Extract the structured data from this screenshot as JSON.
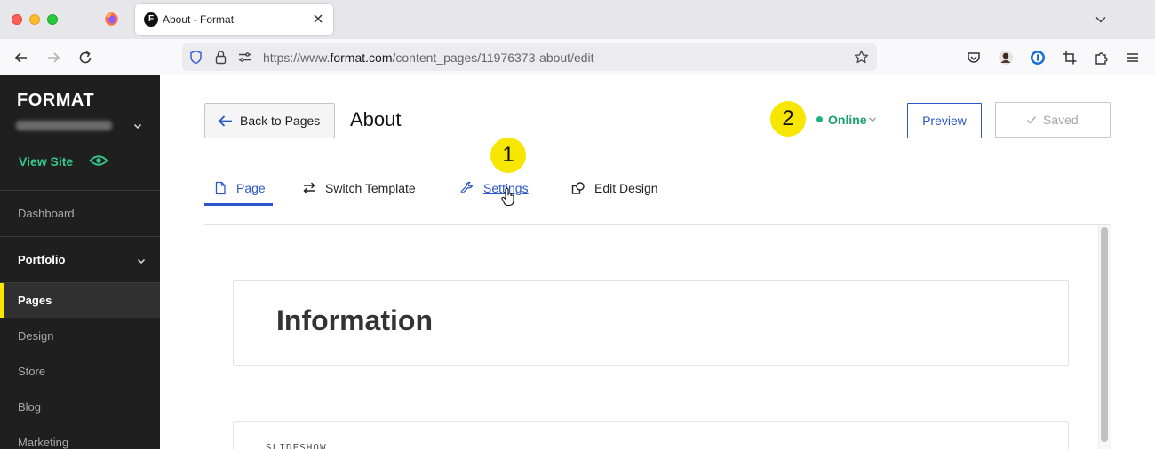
{
  "browser": {
    "tab_title": "About - Format",
    "tab_favicon_letter": "F",
    "url_prefix": "https://www.",
    "url_host": "format.com",
    "url_path": "/content_pages/11976373-about/edit"
  },
  "sidebar": {
    "brand": "FORMAT",
    "view_site": "View Site",
    "items": {
      "dashboard": "Dashboard",
      "portfolio": "Portfolio",
      "pages": "Pages",
      "design": "Design",
      "store": "Store",
      "blog": "Blog",
      "marketing": "Marketing"
    }
  },
  "header": {
    "back_label": "Back to Pages",
    "title": "About",
    "status": "Online",
    "preview": "Preview",
    "saved": "Saved"
  },
  "annotations": {
    "badge1": "1",
    "badge2": "2"
  },
  "tabs": {
    "page": "Page",
    "switch_template": "Switch Template",
    "settings": "Settings",
    "edit_design": "Edit Design"
  },
  "content": {
    "info_heading": "Information",
    "slideshow_label": "SLIDESHOW"
  },
  "colors": {
    "accent_blue": "#2c56c9",
    "online_green": "#19b37b",
    "badge_yellow": "#f7e600",
    "sidebar_bg": "#1f1f1f",
    "view_site_green": "#33c98a"
  }
}
